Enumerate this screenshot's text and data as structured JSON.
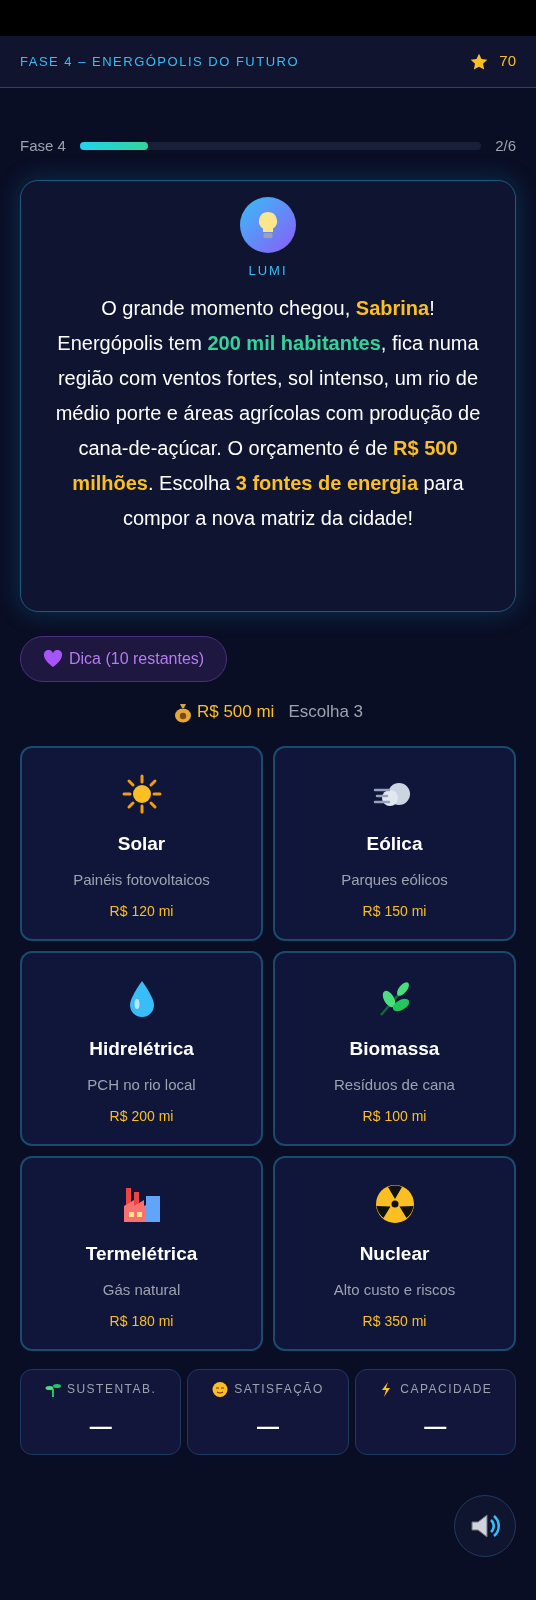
{
  "header": {
    "title": "FASE 4 – ENERGÓPOLIS DO FUTURO",
    "score": "70"
  },
  "progress": {
    "label": "Fase 4",
    "level": 0.17,
    "reading": "2/6"
  },
  "assistant": {
    "name": "LUMI",
    "message": [
      {
        "text": "O grande momento chegou, "
      },
      {
        "text": "Sabrina",
        "color": "#fbbf24"
      },
      {
        "text": "! Energópolis tem "
      },
      {
        "text": "200 mil habitantes",
        "color": "#34d399"
      },
      {
        "text": ", fica numa região com ventos fortes, sol intenso, um rio de médio porte e áreas agrícolas com produção de cana-de-açúcar. O orçamento é de "
      },
      {
        "text": "R$ 500 milhões",
        "color": "#fbbf24"
      },
      {
        "text": ". Escolha "
      },
      {
        "text": "3 fontes de energia",
        "color": "#fbbf24"
      },
      {
        "text": " para compor a nova matriz da cidade!"
      }
    ]
  },
  "hint_button": "Dica (10 restantes)",
  "budget": {
    "amount": "R$ 500 mi",
    "instruction": "Escolha 3"
  },
  "options": [
    {
      "name": "Solar",
      "description": "Painéis fotovoltaicos",
      "cost": "R$ 120 mi",
      "selected": false
    },
    {
      "name": "Eólica",
      "description": "Parques eólicos",
      "cost": "R$ 150 mi",
      "selected": false
    },
    {
      "name": "Hidrelétrica",
      "description": "PCH no rio local",
      "cost": "R$ 200 mi",
      "selected": false
    },
    {
      "name": "Biomassa",
      "description": "Resíduos de cana",
      "cost": "R$ 100 mi",
      "selected": false
    },
    {
      "name": "Termelétrica",
      "description": "Gás natural",
      "cost": "R$ 180 mi",
      "selected": false
    },
    {
      "name": "Nuclear",
      "description": "Alto custo e riscos",
      "cost": "R$ 350 mi",
      "selected": false
    }
  ],
  "stats": [
    {
      "label": "SUSTENTAB.",
      "value": "—"
    },
    {
      "label": "SATISFAÇÃO",
      "value": "—"
    },
    {
      "label": "CAPACIDADE",
      "value": "—"
    }
  ]
}
